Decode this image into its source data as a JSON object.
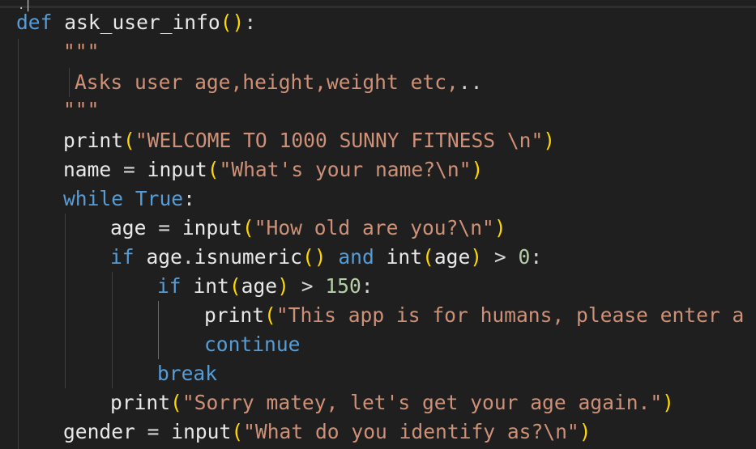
{
  "editor": {
    "top_mark": ".|",
    "lines": [
      {
        "tokens": [
          [
            "kw",
            "def"
          ],
          [
            "op",
            " "
          ],
          [
            "fn2",
            "ask_user_info"
          ],
          [
            "br",
            "()"
          ],
          [
            "op",
            ":"
          ]
        ]
      },
      {
        "tokens": [
          [
            "str",
            "\"\"\""
          ]
        ]
      },
      {
        "tokens": [
          [
            "str",
            "Asks user age,height,weight etc,"
          ],
          [
            "op",
            ".."
          ]
        ]
      },
      {
        "tokens": [
          [
            "str",
            "\"\"\""
          ]
        ]
      },
      {
        "tokens": [
          [
            "fn2",
            "print"
          ],
          [
            "br",
            "("
          ],
          [
            "str",
            "\"WELCOME TO 1000 SUNNY FITNESS \\n\""
          ],
          [
            "br",
            ")"
          ]
        ]
      },
      {
        "tokens": [
          [
            "var",
            "name"
          ],
          [
            "op",
            " = "
          ],
          [
            "fn2",
            "input"
          ],
          [
            "br",
            "("
          ],
          [
            "str",
            "\"What's your name?\\n\""
          ],
          [
            "br",
            ")"
          ]
        ]
      },
      {
        "tokens": [
          [
            "kw",
            "while"
          ],
          [
            "op",
            " "
          ],
          [
            "kw",
            "True"
          ],
          [
            "op",
            ":"
          ]
        ]
      },
      {
        "tokens": [
          [
            "var",
            "age"
          ],
          [
            "op",
            " = "
          ],
          [
            "fn2",
            "input"
          ],
          [
            "br",
            "("
          ],
          [
            "str",
            "\"How old are you?\\n\""
          ],
          [
            "br",
            ")"
          ]
        ]
      },
      {
        "tokens": [
          [
            "kw",
            "if"
          ],
          [
            "op",
            " "
          ],
          [
            "var",
            "age"
          ],
          [
            "op",
            "."
          ],
          [
            "fn2",
            "isnumeric"
          ],
          [
            "br",
            "()"
          ],
          [
            "op",
            " "
          ],
          [
            "kw",
            "and"
          ],
          [
            "op",
            " "
          ],
          [
            "fn2",
            "int"
          ],
          [
            "br",
            "("
          ],
          [
            "var",
            "age"
          ],
          [
            "br",
            ")"
          ],
          [
            "op",
            " > "
          ],
          [
            "num",
            "0"
          ],
          [
            "op",
            ":"
          ]
        ]
      },
      {
        "tokens": [
          [
            "kw",
            "if"
          ],
          [
            "op",
            " "
          ],
          [
            "fn2",
            "int"
          ],
          [
            "br",
            "("
          ],
          [
            "var",
            "age"
          ],
          [
            "br",
            ")"
          ],
          [
            "op",
            " > "
          ],
          [
            "num",
            "150"
          ],
          [
            "op",
            ":"
          ]
        ]
      },
      {
        "tokens": [
          [
            "fn2",
            "print"
          ],
          [
            "br",
            "("
          ],
          [
            "str",
            "\"This app is for humans, please enter a hu"
          ]
        ]
      },
      {
        "tokens": [
          [
            "kw",
            "continue"
          ]
        ]
      },
      {
        "tokens": [
          [
            "kw",
            "break"
          ]
        ]
      },
      {
        "tokens": [
          [
            "fn2",
            "print"
          ],
          [
            "br",
            "("
          ],
          [
            "str",
            "\"Sorry matey, let's get your age again.\""
          ],
          [
            "br",
            ")"
          ]
        ]
      },
      {
        "tokens": [
          [
            "var",
            "gender"
          ],
          [
            "op",
            " = "
          ],
          [
            "fn2",
            "input"
          ],
          [
            "br",
            "("
          ],
          [
            "str",
            "\"What do you identify as?\\n\""
          ],
          [
            "br",
            ")"
          ]
        ]
      }
    ]
  }
}
